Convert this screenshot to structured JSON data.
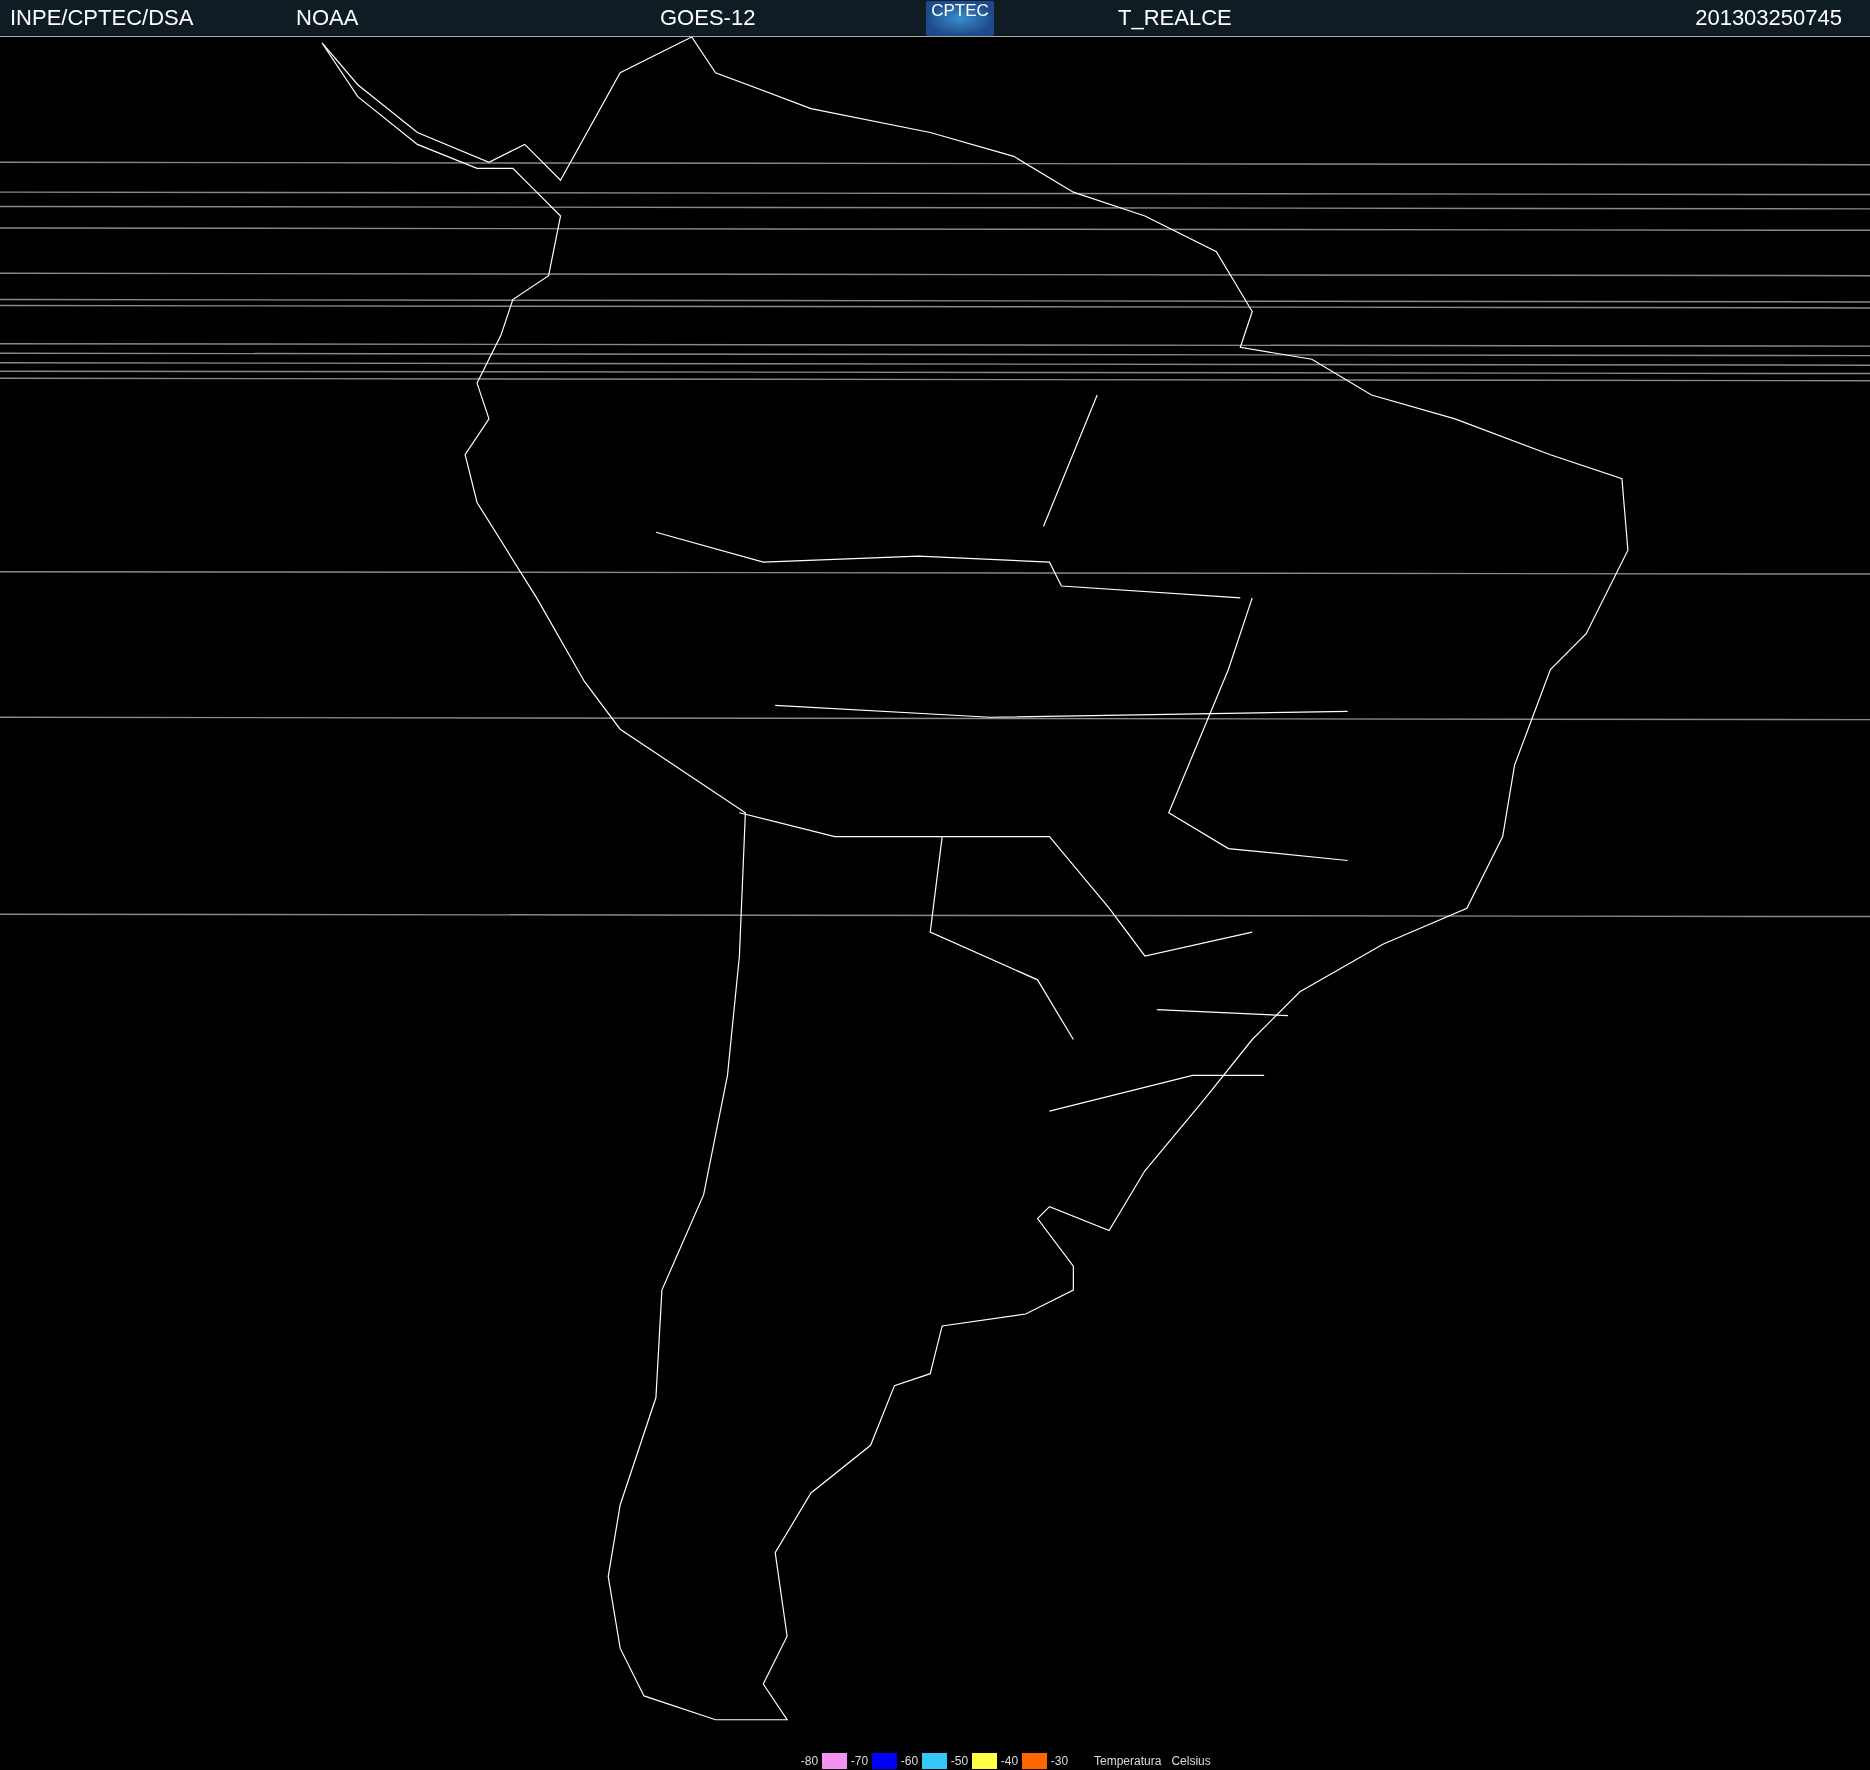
{
  "header": {
    "agency": "INPE/CPTEC/DSA",
    "source": "NOAA",
    "satellite": "GOES-12",
    "logo": "CPTEC",
    "product": "T_REALCE",
    "timestamp": "201303250745"
  },
  "legend": {
    "items": [
      {
        "label": "-80",
        "color": "#f392f0"
      },
      {
        "label": "-70",
        "color": "#0000ff"
      },
      {
        "label": "-60",
        "color": "#33c8f5"
      },
      {
        "label": "-50",
        "color": "#ffff44"
      },
      {
        "label": "-40",
        "color": "#ff6600"
      },
      {
        "label": "-30"
      }
    ],
    "title": "Temperatura",
    "unit": "Celsius"
  }
}
